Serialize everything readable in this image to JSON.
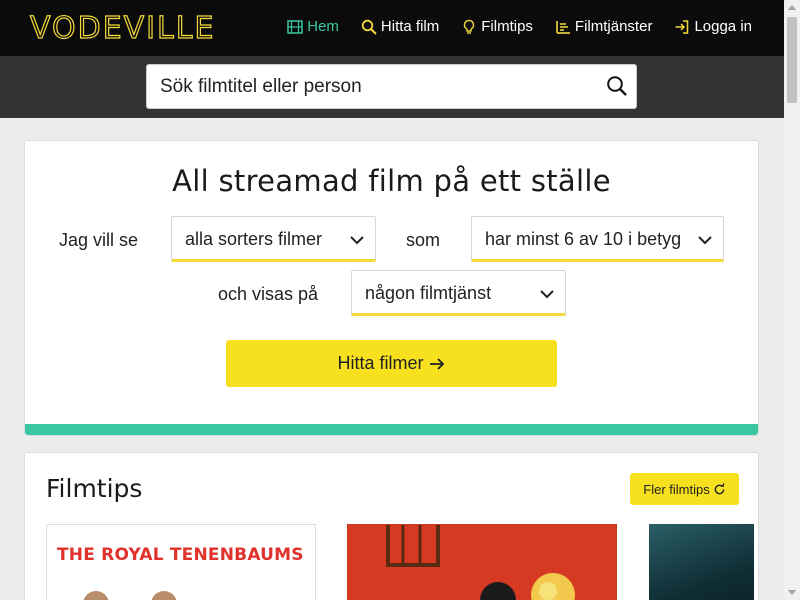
{
  "brand": {
    "logo": "VODEVILLE",
    "accent": "#f3d93a",
    "teal": "#3bc6a2"
  },
  "nav": {
    "items": [
      {
        "label": "Hem",
        "icon": "film-icon",
        "active": true
      },
      {
        "label": "Hitta film",
        "icon": "search-icon",
        "active": false
      },
      {
        "label": "Filmtips",
        "icon": "lightbulb-icon",
        "active": false
      },
      {
        "label": "Filmtjänster",
        "icon": "list-icon",
        "active": false
      },
      {
        "label": "Logga in",
        "icon": "sign-in-icon",
        "active": false
      }
    ]
  },
  "search": {
    "placeholder": "Sök filmtitel eller person"
  },
  "hero": {
    "title": "All streamad film på ett ställe",
    "label_want": "Jag vill se",
    "dropdown_genre": "alla sorters filmer",
    "label_som": "som",
    "dropdown_rating": "har minst 6 av 10 i betyg",
    "label_shown": "och visas på",
    "dropdown_service": "någon filmtjänst",
    "find_button": "Hitta filmer"
  },
  "tips": {
    "title": "Filmtips",
    "more_button": "Fler filmtips",
    "posters": [
      {
        "title": "THE ROYAL TENENBAUMS"
      }
    ]
  }
}
